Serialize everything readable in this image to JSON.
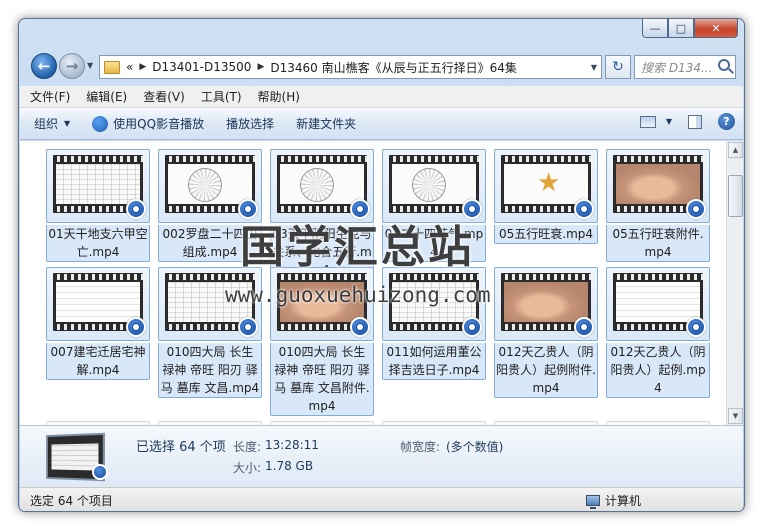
{
  "window": {
    "close_glyph": "✕",
    "maximize_glyph": "□",
    "minimize_glyph": "—"
  },
  "nav": {
    "back_glyph": "←",
    "forward_glyph": "→",
    "overflow": "«",
    "crumbs": [
      "D13401-D13500",
      "D13460 南山樵客《从辰与正五行择日》64集"
    ],
    "search_placeholder": "搜索 D134...",
    "refresh_glyph": "↻"
  },
  "menu": [
    "文件(F)",
    "编辑(E)",
    "查看(V)",
    "工具(T)",
    "帮助(H)"
  ],
  "toolbar": {
    "organize": "组织",
    "play_qq": "使用QQ影音播放",
    "play_select": "播放选择",
    "new_folder": "新建文件夹",
    "help_glyph": "?"
  },
  "files": [
    {
      "name": "01天干地支六甲空亡.mp4",
      "frame": "table"
    },
    {
      "name": "002罗盘二十四山组成.mp4",
      "frame": "chart"
    },
    {
      "name": "03天干阴阳生克与关系、化合五行.mp4",
      "frame": "chart"
    },
    {
      "name": "04二十四节气.mp4",
      "frame": "chart"
    },
    {
      "name": "05五行旺衰.mp4",
      "frame": "star"
    },
    {
      "name": "05五行旺衰附件.mp4",
      "frame": "hand"
    },
    {
      "name": "007建宅迁居宅神解.mp4",
      "frame": "text"
    },
    {
      "name": "010四大局 长生 禄神 帝旺 阳刃 驿马 墓库 文昌.mp4",
      "frame": "table"
    },
    {
      "name": "010四大局 长生 禄神 帝旺 阳刃 驿马 墓库 文昌附件.mp4",
      "frame": "hand"
    },
    {
      "name": "011如何运用董公择吉选日子.mp4",
      "frame": "table"
    },
    {
      "name": "012天乙贵人（阴阳贵人）起例附件.mp4",
      "frame": "hand"
    },
    {
      "name": "012天乙贵人（阴阳贵人）起例.mp4",
      "frame": "text"
    }
  ],
  "watermark": {
    "title": "国学汇总站",
    "url": "www.guoxuehuizong.com"
  },
  "details": {
    "selected": "已选择 64 个项",
    "length_label": "长度:",
    "length_value": "13:28:11",
    "size_label": "大小:",
    "size_value": "1.78 GB",
    "frame_width_label": "帧宽度:",
    "frame_width_value": "(多个数值)"
  },
  "status": {
    "selected_text": "选定 64 个项目",
    "computer": "计算机"
  }
}
